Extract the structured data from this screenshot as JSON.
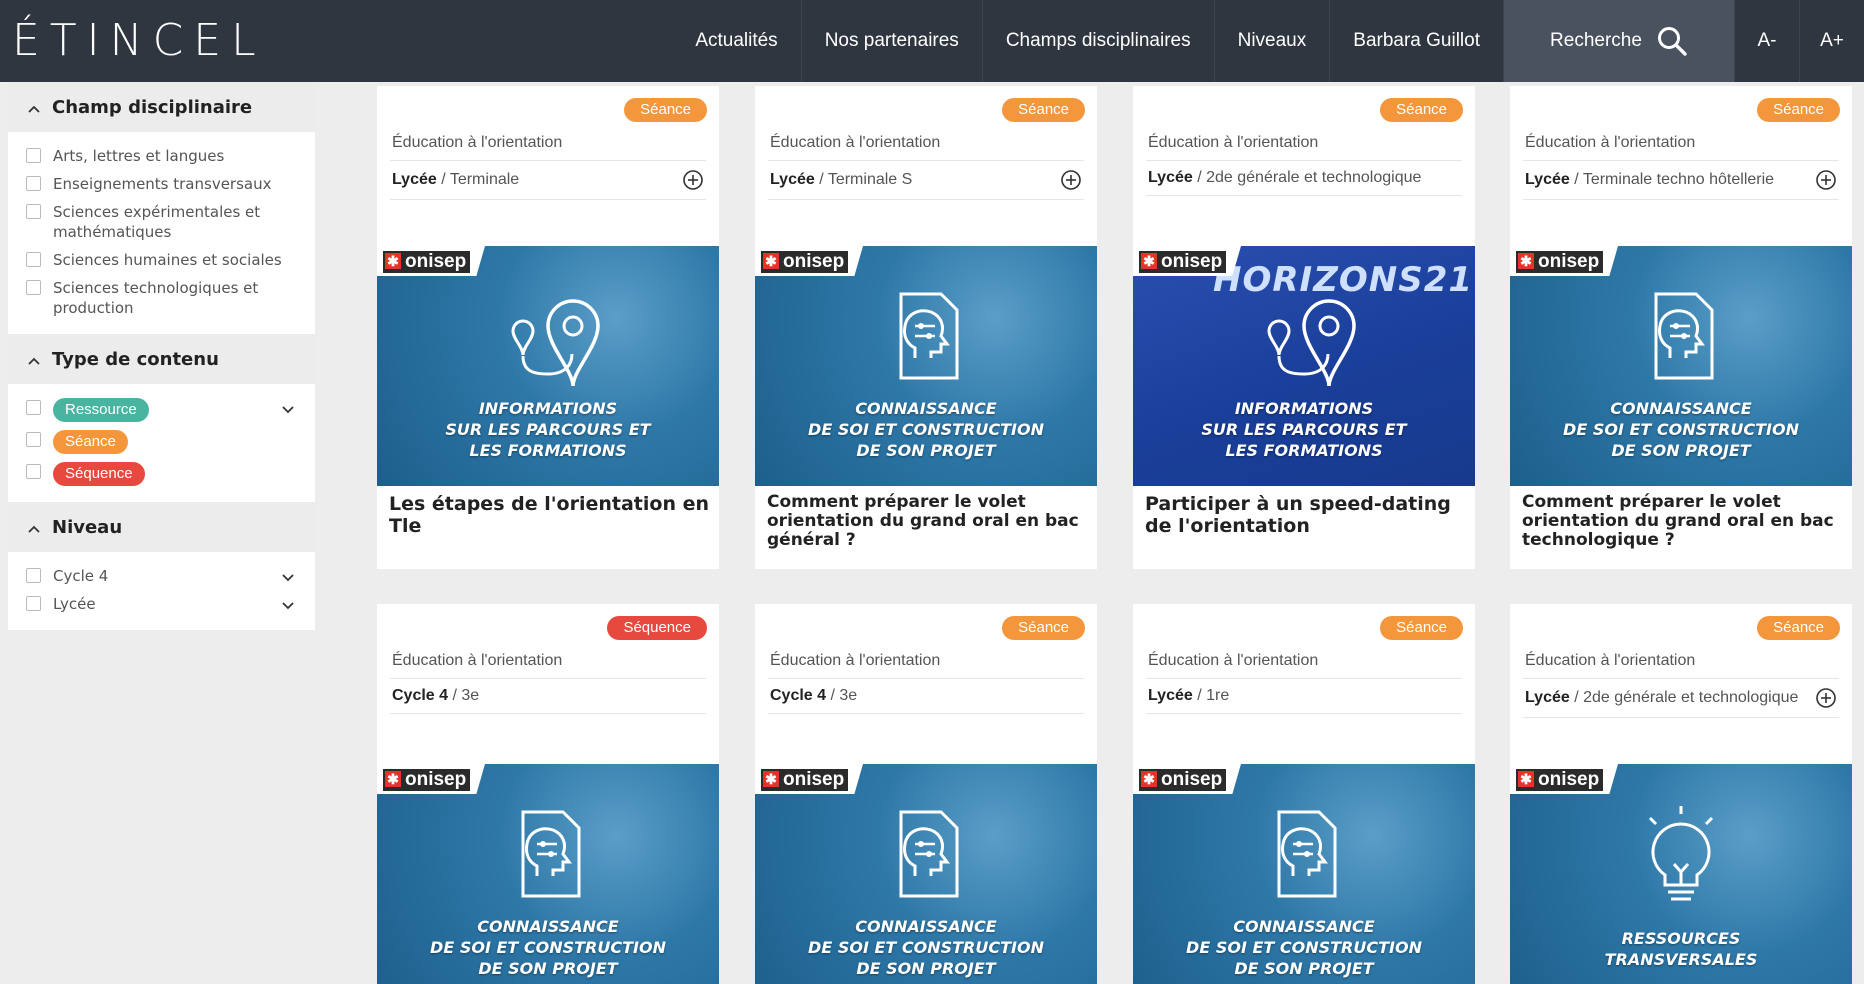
{
  "brand": {
    "logo": "ÉTINCEL"
  },
  "nav": {
    "items": [
      "Actualités",
      "Nos partenaires",
      "Champs disciplinaires",
      "Niveaux",
      "Barbara Guillot"
    ],
    "search_label": "Recherche",
    "font_decrease": "A-",
    "font_increase": "A+"
  },
  "colors": {
    "header": "#2f3640",
    "ressource": "#49b4a0",
    "seance": "#f4963b",
    "sequence": "#e8493e",
    "thumb": "#1f6fa0"
  },
  "sidebar": {
    "facets": [
      {
        "title": "Champ disciplinaire",
        "options": [
          "Arts, lettres et langues",
          "Enseignements transversaux",
          "Sciences expérimentales et mathématiques",
          "Sciences humaines et sociales",
          "Sciences technologiques et production"
        ]
      },
      {
        "title": "Type de contenu",
        "options": [
          "Ressource",
          "Séance",
          "Séquence"
        ]
      },
      {
        "title": "Niveau",
        "options": [
          "Cycle 4",
          "Lycée"
        ]
      }
    ]
  },
  "cards": [
    {
      "tag": "Séance",
      "field": "Éducation à l'orientation",
      "level_bold": "Lycée",
      "level_rest": " / Terminale",
      "thumb_lines": [
        "INFORMATIONS",
        "SUR LES PARCOURS ET",
        "LES FORMATIONS"
      ],
      "title": "Les étapes de l'orientation en Tle",
      "thumb_brand": "onisep"
    },
    {
      "tag": "Séance",
      "field": "Éducation à l'orientation",
      "level_bold": "Lycée",
      "level_rest": " / Terminale S",
      "thumb_lines": [
        "CONNAISSANCE",
        "DE SOI ET CONSTRUCTION",
        "DE SON PROJET"
      ],
      "title": "Comment préparer le volet orientation du grand oral en bac général ?",
      "thumb_brand": "onisep"
    },
    {
      "tag": "Séance",
      "field": "Éducation à l'orientation",
      "level_bold": "Lycée",
      "level_rest": " / 2de générale et technologique",
      "thumb_lines": [
        "INFORMATIONS",
        "SUR LES PARCOURS ET",
        "LES FORMATIONS"
      ],
      "thumb_top": "HORIZONS21",
      "title": "Participer à un speed-dating de l'orientation",
      "thumb_brand": "onisep"
    },
    {
      "tag": "Séance",
      "field": "Éducation à l'orientation",
      "level_bold": "Lycée",
      "level_rest": " / Terminale techno hôtellerie",
      "thumb_lines": [
        "CONNAISSANCE",
        "DE SOI ET CONSTRUCTION",
        "DE SON PROJET"
      ],
      "title": "Comment préparer le volet orientation du grand oral en bac technologique ?",
      "thumb_brand": "onisep"
    },
    {
      "tag": "Séquence",
      "field": "Éducation à l'orientation",
      "level_bold": "Cycle 4",
      "level_rest": " / 3e",
      "thumb_lines": [
        "CONNAISSANCE",
        "DE SOI ET CONSTRUCTION",
        "DE SON PROJET"
      ],
      "title": "",
      "thumb_brand": "onisep"
    },
    {
      "tag": "Séance",
      "field": "Éducation à l'orientation",
      "level_bold": "Cycle 4",
      "level_rest": " / 3e",
      "thumb_lines": [
        "CONNAISSANCE",
        "DE SOI ET CONSTRUCTION",
        "DE SON PROJET"
      ],
      "title": "",
      "thumb_brand": "onisep"
    },
    {
      "tag": "Séance",
      "field": "Éducation à l'orientation",
      "level_bold": "Lycée",
      "level_rest": " / 1re",
      "thumb_lines": [
        "CONNAISSANCE",
        "DE SOI ET CONSTRUCTION",
        "DE SON PROJET"
      ],
      "title": "",
      "thumb_brand": "onisep"
    },
    {
      "tag": "Séance",
      "field": "Éducation à l'orientation",
      "level_bold": "Lycée",
      "level_rest": " / 2de générale et technologique",
      "thumb_lines": [
        "RESSOURCES",
        "TRANSVERSALES"
      ],
      "title": "",
      "thumb_brand": "onisep"
    }
  ]
}
